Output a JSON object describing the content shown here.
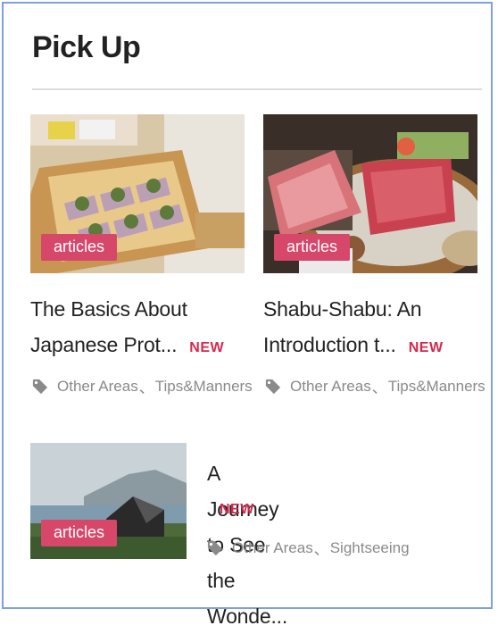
{
  "section": {
    "title": "Pick Up"
  },
  "cards": [
    {
      "badge": "articles",
      "title_line1": "The Basics About",
      "title_line2": "Japanese Prot...",
      "new_label": "NEW",
      "tags": [
        "Other Areas",
        "Tips&Manners"
      ],
      "separator": "、"
    },
    {
      "badge": "articles",
      "title_line1": "Shabu-Shabu: An",
      "title_line2": "Introduction t...",
      "new_label": "NEW",
      "tags": [
        "Other Areas",
        "Tips&Manners"
      ],
      "separator": "、"
    },
    {
      "badge": "articles",
      "title_line1": "A Journey to See the Wonde...",
      "new_label": "NEW",
      "tags": [
        "Other Areas",
        "Sightseeing"
      ],
      "separator": "、"
    }
  ],
  "colors": {
    "badge": "#d6476a",
    "new": "#d6294f",
    "frame": "#7f9fe0"
  },
  "icons": {
    "tag": "tag-icon"
  }
}
